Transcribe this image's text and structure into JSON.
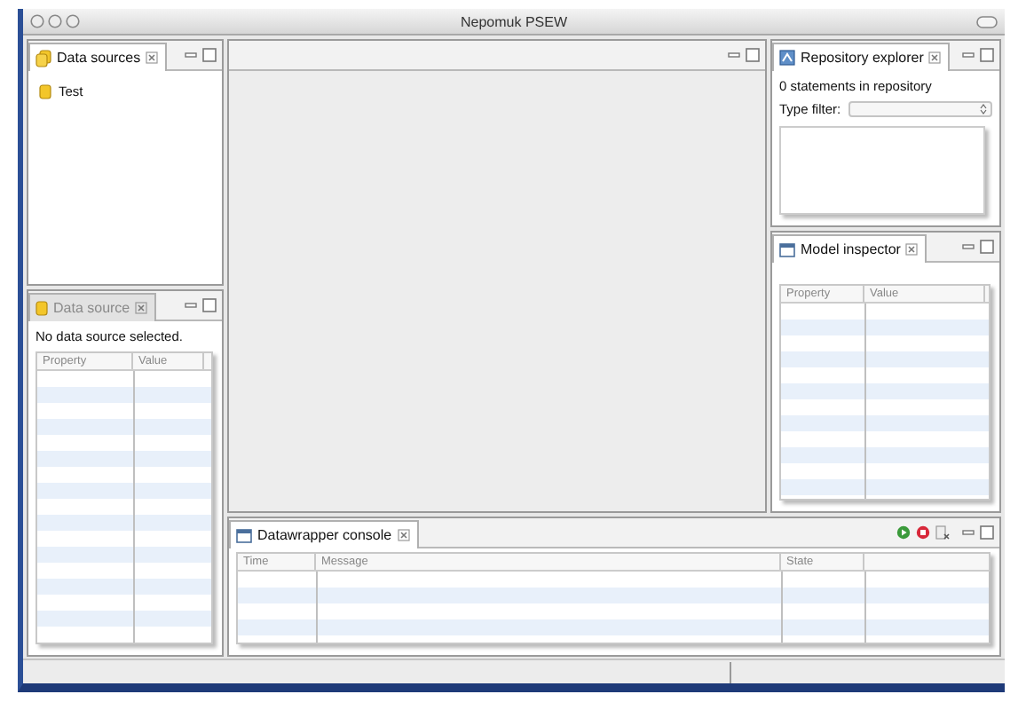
{
  "window": {
    "title": "Nepomuk PSEW"
  },
  "data_sources": {
    "tab": {
      "label": "Data sources",
      "active": true
    },
    "items": [
      {
        "label": "Test"
      }
    ]
  },
  "data_source": {
    "tab": {
      "label": "Data source",
      "active": false
    },
    "message": "No data source selected.",
    "table": {
      "columns": [
        "Property",
        "Value"
      ]
    }
  },
  "repository_explorer": {
    "tab": {
      "label": "Repository explorer",
      "active": true
    },
    "status": "0 statements in repository",
    "type_filter": {
      "label": "Type filter:"
    }
  },
  "model_inspector": {
    "tab": {
      "label": "Model inspector",
      "active": true
    },
    "table": {
      "columns": [
        "Property",
        "Value"
      ]
    }
  },
  "console": {
    "tab": {
      "label": "Datawrapper console",
      "active": true
    },
    "table": {
      "columns": [
        "Time",
        "Message",
        "State"
      ]
    }
  }
}
